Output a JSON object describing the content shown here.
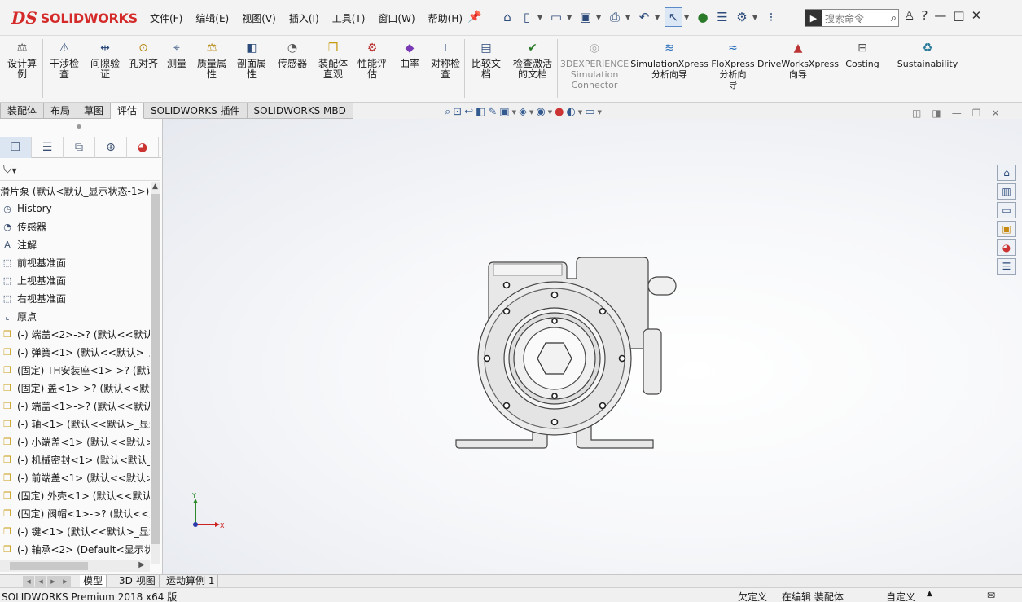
{
  "app": {
    "brand_ds": "DS",
    "brand_name": "SOLIDWORKS"
  },
  "menu": [
    "文件(F)",
    "编辑(E)",
    "视图(V)",
    "插入(I)",
    "工具(T)",
    "窗口(W)",
    "帮助(H)"
  ],
  "quick_access": [
    "home-icon",
    "new-document-icon",
    "open-icon",
    "save-icon",
    "print-icon",
    "undo-icon",
    "select-icon",
    "rebuild-icon",
    "file-properties-icon",
    "options-icon"
  ],
  "search": {
    "placeholder": "搜索命令"
  },
  "window_controls": [
    "user-icon",
    "help-icon",
    "minimize-icon",
    "maximize-icon",
    "close-icon"
  ],
  "ribbon": {
    "design_study": "设计算\n例",
    "commands": [
      {
        "label": "干涉检\n查",
        "icon": "interference-icon"
      },
      {
        "label": "间隙验\n证",
        "icon": "clearance-icon"
      },
      {
        "label": "孔对齐",
        "icon": "hole-alignment-icon"
      },
      {
        "label": "测量",
        "icon": "measure-icon"
      },
      {
        "label": "质量属\n性",
        "icon": "mass-properties-icon"
      },
      {
        "label": "剖面属\n性",
        "icon": "section-properties-icon"
      },
      {
        "label": "传感器",
        "icon": "sensor-icon"
      },
      {
        "label": "装配体\n直观",
        "icon": "assembly-visualization-icon"
      },
      {
        "label": "性能评\n估",
        "icon": "performance-evaluation-icon"
      },
      {
        "label": "曲率",
        "icon": "curvature-icon"
      },
      {
        "label": "对称检\n查",
        "icon": "symmetry-check-icon"
      },
      {
        "label": "比较文\n档",
        "icon": "compare-documents-icon"
      },
      {
        "label": "检查激活\n的文档",
        "icon": "check-active-document-icon"
      },
      {
        "label": "3DEXPERIENCE\nSimulation\nConnector",
        "icon": "3dexperience-icon"
      },
      {
        "label": "SimulationXpress\n分析向导",
        "icon": "simulationxpress-icon"
      },
      {
        "label": "FloXpress\n分析向\n导",
        "icon": "floxpress-icon"
      },
      {
        "label": "DriveWorksXpress\n向导",
        "icon": "driveworksxpress-icon"
      },
      {
        "label": "Costing",
        "icon": "costing-icon"
      },
      {
        "label": "Sustainability",
        "icon": "sustainability-icon"
      }
    ]
  },
  "tabs": [
    "装配体",
    "布局",
    "草图",
    "评估",
    "SOLIDWORKS 插件",
    "SOLIDWORKS MBD"
  ],
  "active_tab": "评估",
  "feature_tree": {
    "root": "滑片泵 (默认<默认_显示状态-1>)",
    "items": [
      {
        "label": "History",
        "icon": "history-icon"
      },
      {
        "label": "传感器",
        "icon": "sensor-folder-icon"
      },
      {
        "label": "注解",
        "icon": "annotations-icon"
      },
      {
        "label": "前视基准面",
        "icon": "plane-icon"
      },
      {
        "label": "上视基准面",
        "icon": "plane-icon"
      },
      {
        "label": "右视基准面",
        "icon": "plane-icon"
      },
      {
        "label": "原点",
        "icon": "origin-icon"
      },
      {
        "label": "(-) 端盖<2>->? (默认<<默认",
        "icon": "part-icon"
      },
      {
        "label": "(-) 弹簧<1> (默认<<默认>_显",
        "icon": "part-icon"
      },
      {
        "label": "(固定) TH安装座<1>->? (默认",
        "icon": "part-icon"
      },
      {
        "label": "(固定) 盖<1>->? (默认<<默认",
        "icon": "part-icon"
      },
      {
        "label": "(-) 端盖<1>->? (默认<<默认",
        "icon": "part-icon"
      },
      {
        "label": "(-) 轴<1> (默认<<默认>_显示",
        "icon": "part-icon"
      },
      {
        "label": "(-) 小端盖<1> (默认<<默认>_",
        "icon": "part-icon"
      },
      {
        "label": "(-) 机械密封<1> (默认<默认_",
        "icon": "part-icon"
      },
      {
        "label": "(-) 前端盖<1> (默认<<默认>_",
        "icon": "part-icon"
      },
      {
        "label": "(固定) 外壳<1> (默认<<默认:",
        "icon": "part-icon"
      },
      {
        "label": "(固定) 阀帽<1>->? (默认<<默",
        "icon": "part-icon"
      },
      {
        "label": "(-) 键<1> (默认<<默认>_显示",
        "icon": "part-icon"
      },
      {
        "label": "(-) 轴承<2> (Default<显示状",
        "icon": "part-icon"
      }
    ]
  },
  "triad": {
    "x": "X",
    "y": "Y"
  },
  "bottom_tabs": [
    "模型",
    "3D 视图",
    "运动算例 1"
  ],
  "status": {
    "product": "SOLIDWORKS Premium 2018 x64 版",
    "definition": "欠定义",
    "editing": "在编辑 装配体",
    "units": "自定义"
  },
  "colors": {
    "accent": "#d42a2a",
    "active_panel_tab": "#dce6f2"
  }
}
